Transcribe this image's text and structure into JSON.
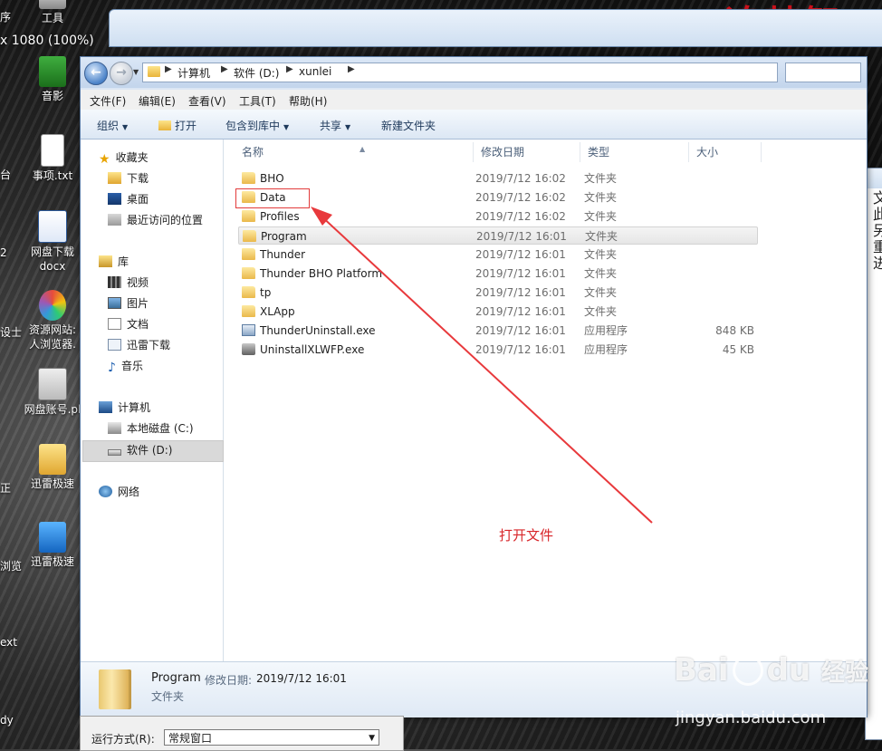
{
  "desktop": {
    "banner": "追梦智",
    "resolution": "x 1080 (100%)",
    "icons": [
      {
        "label": "工具"
      },
      {
        "label": "音影"
      },
      {
        "label": "事项.txt"
      },
      {
        "label": "网盘下载",
        "label2": "docx"
      },
      {
        "label": "资源网站:",
        "label2": "人浏览器."
      },
      {
        "label": "网盘账号.pl"
      },
      {
        "label": "迅雷极速"
      },
      {
        "label": "迅雷极速"
      }
    ],
    "edge_labels": [
      "序",
      "台",
      "2",
      "设士",
      "正",
      "浏览",
      "ext",
      "dy"
    ]
  },
  "right_window": {
    "text": [
      "文",
      "此",
      "另",
      "重",
      "进"
    ]
  },
  "explorer": {
    "breadcrumb": [
      "计算机",
      "软件 (D:)",
      "xunlei"
    ],
    "menu": [
      "文件(F)",
      "编辑(E)",
      "查看(V)",
      "工具(T)",
      "帮助(H)"
    ],
    "toolbar": {
      "organize": "组织",
      "open": "打开",
      "include": "包含到库中",
      "share": "共享",
      "new_folder": "新建文件夹"
    },
    "nav": {
      "favorites": "收藏夹",
      "downloads": "下载",
      "desktop": "桌面",
      "recent": "最近访问的位置",
      "libraries": "库",
      "videos": "视频",
      "pictures": "图片",
      "documents": "文档",
      "thunder_dl": "迅雷下载",
      "music": "音乐",
      "computer": "计算机",
      "local_c": "本地磁盘 (C:)",
      "soft_d": "软件 (D:)",
      "network": "网络"
    },
    "columns": {
      "name": "名称",
      "date": "修改日期",
      "type": "类型",
      "size": "大小"
    },
    "files": [
      {
        "name": "BHO",
        "date": "2019/7/12 16:02",
        "type": "文件夹",
        "size": ""
      },
      {
        "name": "Data",
        "date": "2019/7/12 16:02",
        "type": "文件夹",
        "size": ""
      },
      {
        "name": "Profiles",
        "date": "2019/7/12 16:02",
        "type": "文件夹",
        "size": ""
      },
      {
        "name": "Program",
        "date": "2019/7/12 16:01",
        "type": "文件夹",
        "size": ""
      },
      {
        "name": "Thunder",
        "date": "2019/7/12 16:01",
        "type": "文件夹",
        "size": ""
      },
      {
        "name": "Thunder BHO Platform",
        "date": "2019/7/12 16:01",
        "type": "文件夹",
        "size": ""
      },
      {
        "name": "tp",
        "date": "2019/7/12 16:01",
        "type": "文件夹",
        "size": ""
      },
      {
        "name": "XLApp",
        "date": "2019/7/12 16:01",
        "type": "文件夹",
        "size": ""
      },
      {
        "name": "ThunderUninstall.exe",
        "date": "2019/7/12 16:01",
        "type": "应用程序",
        "size": "848 KB"
      },
      {
        "name": "UninstallXLWFP.exe",
        "date": "2019/7/12 16:01",
        "type": "应用程序",
        "size": "45 KB"
      }
    ],
    "details": {
      "name": "Program",
      "date_label": "修改日期:",
      "date_value": "2019/7/12 16:01",
      "type": "文件夹"
    }
  },
  "annotation": {
    "text": "打开文件",
    "color": "#d8262a"
  },
  "run_panel": {
    "label": "运行方式(R):",
    "value": "常规窗口"
  },
  "watermark": {
    "brand_a": "Bai",
    "brand_b": "du",
    "brand_c": "经验",
    "url": "jingyan.baidu.com"
  }
}
